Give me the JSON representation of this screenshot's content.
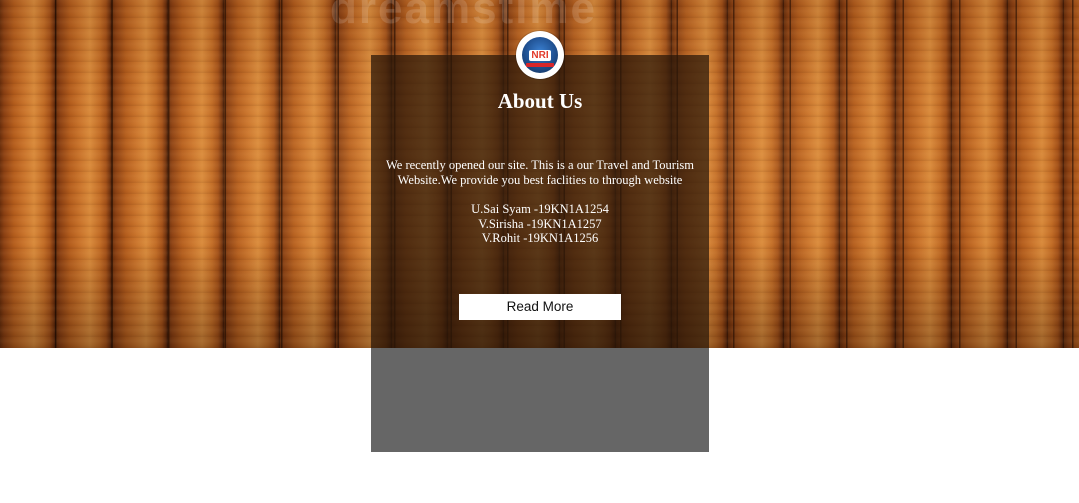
{
  "watermark": "dreamstime",
  "logo": {
    "icon": "brand-logo-icon",
    "text": "NRI"
  },
  "about": {
    "title": "About Us",
    "description_lines": [
      "We recently opened our site. This is a our Travel and Tourism",
      "Website.We provide you best faclities to through website"
    ],
    "members": [
      "U.Sai Syam -19KN1A1254",
      "V.Sirisha -19KN1A1257",
      "V.Rohit -19KN1A1256"
    ],
    "button_label": "Read More"
  },
  "colors": {
    "card_overlay": "#281608",
    "card_lower": "#666666",
    "button_bg": "#ffffff",
    "text": "#ffffff"
  }
}
